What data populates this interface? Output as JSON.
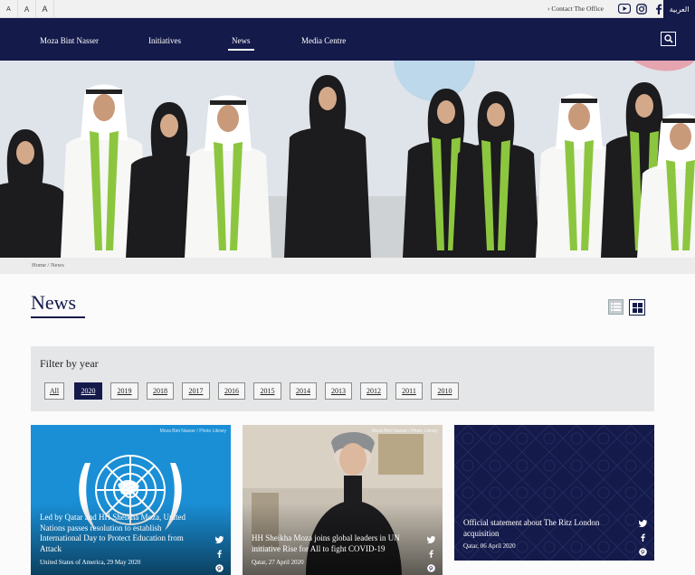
{
  "utility": {
    "font_sizes": [
      "A",
      "A",
      "A"
    ],
    "contact": "› Contact The Office",
    "social_icons": [
      "youtube-icon",
      "instagram-icon",
      "facebook-icon"
    ],
    "language": "العربية"
  },
  "nav": {
    "items": [
      "Moza Bint Nasser",
      "Initiatives",
      "News",
      "Media Centre"
    ],
    "active": "News"
  },
  "breadcrumb": "Home / News",
  "page_title": "News",
  "filter": {
    "title": "Filter by year",
    "years": [
      "All",
      "2020",
      "2019",
      "2018",
      "2017",
      "2016",
      "2015",
      "2014",
      "2013",
      "2012",
      "2011",
      "2010"
    ],
    "active": "2020"
  },
  "cards": [
    {
      "title": "Led by Qatar and HH Sheikha Moza, United Nations passes resolution to establish International Day to Protect Education from Attack",
      "meta": "United States of America, 29 May 2020",
      "watermark": "Moza Bint Nasser / Photo Library"
    },
    {
      "title": "HH Sheikha Moza joins global leaders in UN initiative Rise for All to fight COVID-19",
      "meta": "Qatar, 27 April 2020",
      "watermark": "Moza Bint Nasser / Photo Library"
    },
    {
      "title": "Official statement about The Ritz London acquisition",
      "meta": "Qatar, 06 April 2020",
      "watermark": ""
    }
  ],
  "colors": {
    "navy": "#141a4a",
    "un_blue": "#1a8fd6",
    "green_scarf": "#8cc63f"
  }
}
